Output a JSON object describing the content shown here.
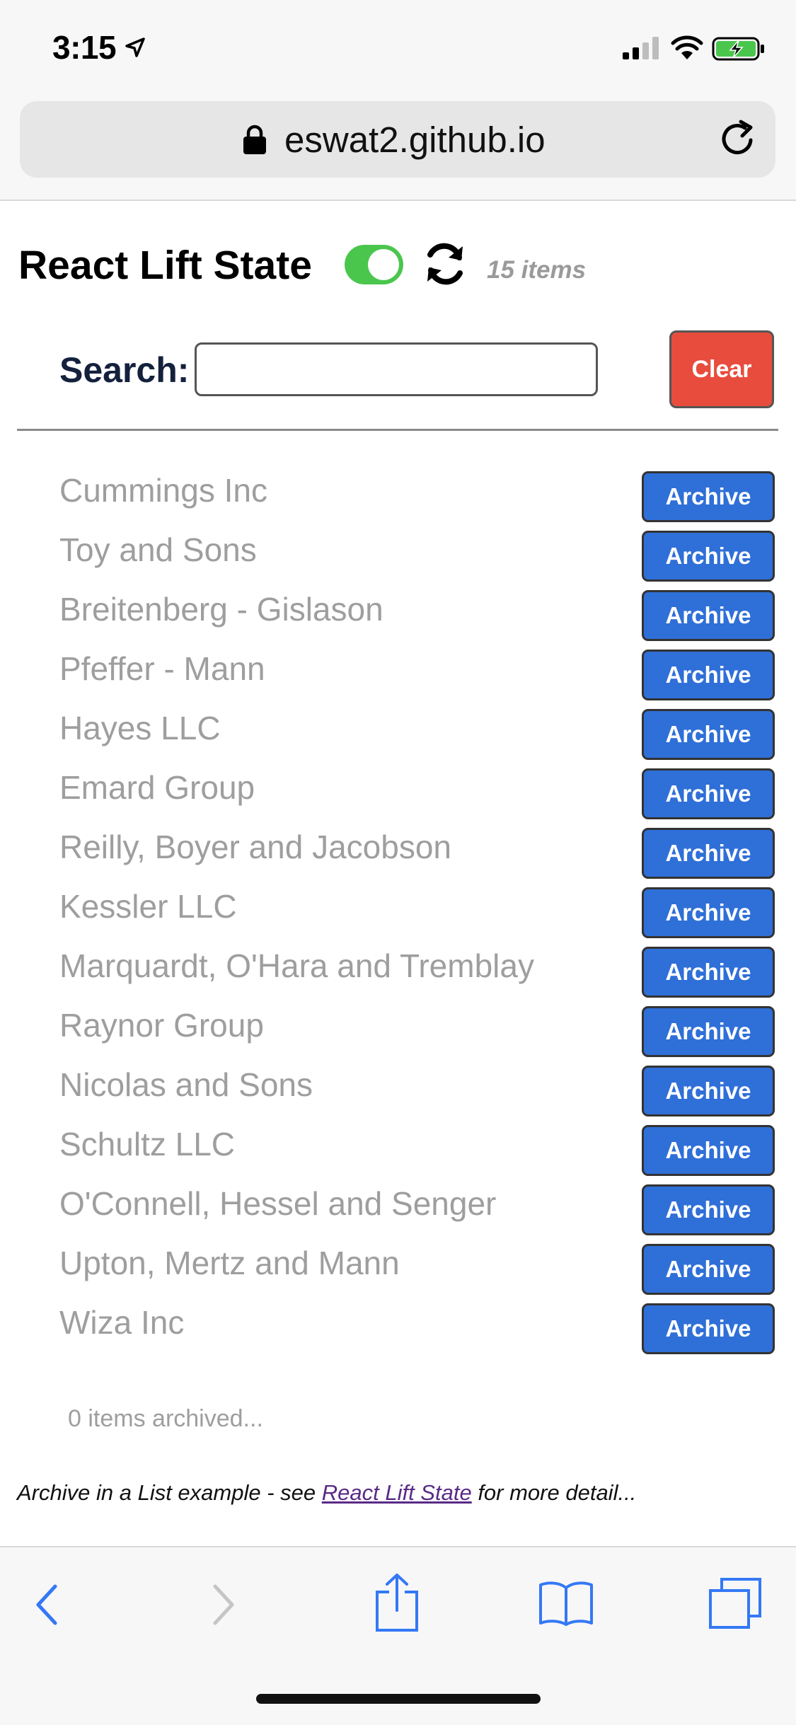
{
  "status_bar": {
    "time": "3:15"
  },
  "browser": {
    "url": "eswat2.github.io"
  },
  "app": {
    "title": "React Lift State",
    "toggle_on": true,
    "item_count": "15 items",
    "search_label": "Search:",
    "search_value": "",
    "clear_label": "Clear",
    "items": [
      {
        "name": "Cummings Inc",
        "action": "Archive"
      },
      {
        "name": "Toy and Sons",
        "action": "Archive"
      },
      {
        "name": "Breitenberg - Gislason",
        "action": "Archive"
      },
      {
        "name": "Pfeffer - Mann",
        "action": "Archive"
      },
      {
        "name": "Hayes LLC",
        "action": "Archive"
      },
      {
        "name": "Emard Group",
        "action": "Archive"
      },
      {
        "name": "Reilly, Boyer and Jacobson",
        "action": "Archive"
      },
      {
        "name": "Kessler LLC",
        "action": "Archive"
      },
      {
        "name": "Marquardt, O'Hara and Tremblay",
        "action": "Archive"
      },
      {
        "name": "Raynor Group",
        "action": "Archive"
      },
      {
        "name": "Nicolas and Sons",
        "action": "Archive"
      },
      {
        "name": "Schultz LLC",
        "action": "Archive"
      },
      {
        "name": "O'Connell, Hessel and Senger",
        "action": "Archive"
      },
      {
        "name": "Upton, Mertz and Mann",
        "action": "Archive"
      },
      {
        "name": "Wiza Inc",
        "action": "Archive"
      }
    ],
    "archived_status": "0 items archived...",
    "footer": {
      "prefix": "Archive in a List example - see ",
      "link_text": "React Lift State",
      "suffix": " for more detail..."
    }
  },
  "toolbar": {
    "icons": [
      "back-icon",
      "forward-icon",
      "share-icon",
      "bookmarks-icon",
      "tabs-icon"
    ]
  },
  "colors": {
    "toggle": "#4ac64d",
    "clear_button": "#e84c3d",
    "archive_button": "#2f6fd8",
    "item_text": "#9e9e9e",
    "link": "#5a2a86",
    "safari_blue": "#3478f6"
  }
}
